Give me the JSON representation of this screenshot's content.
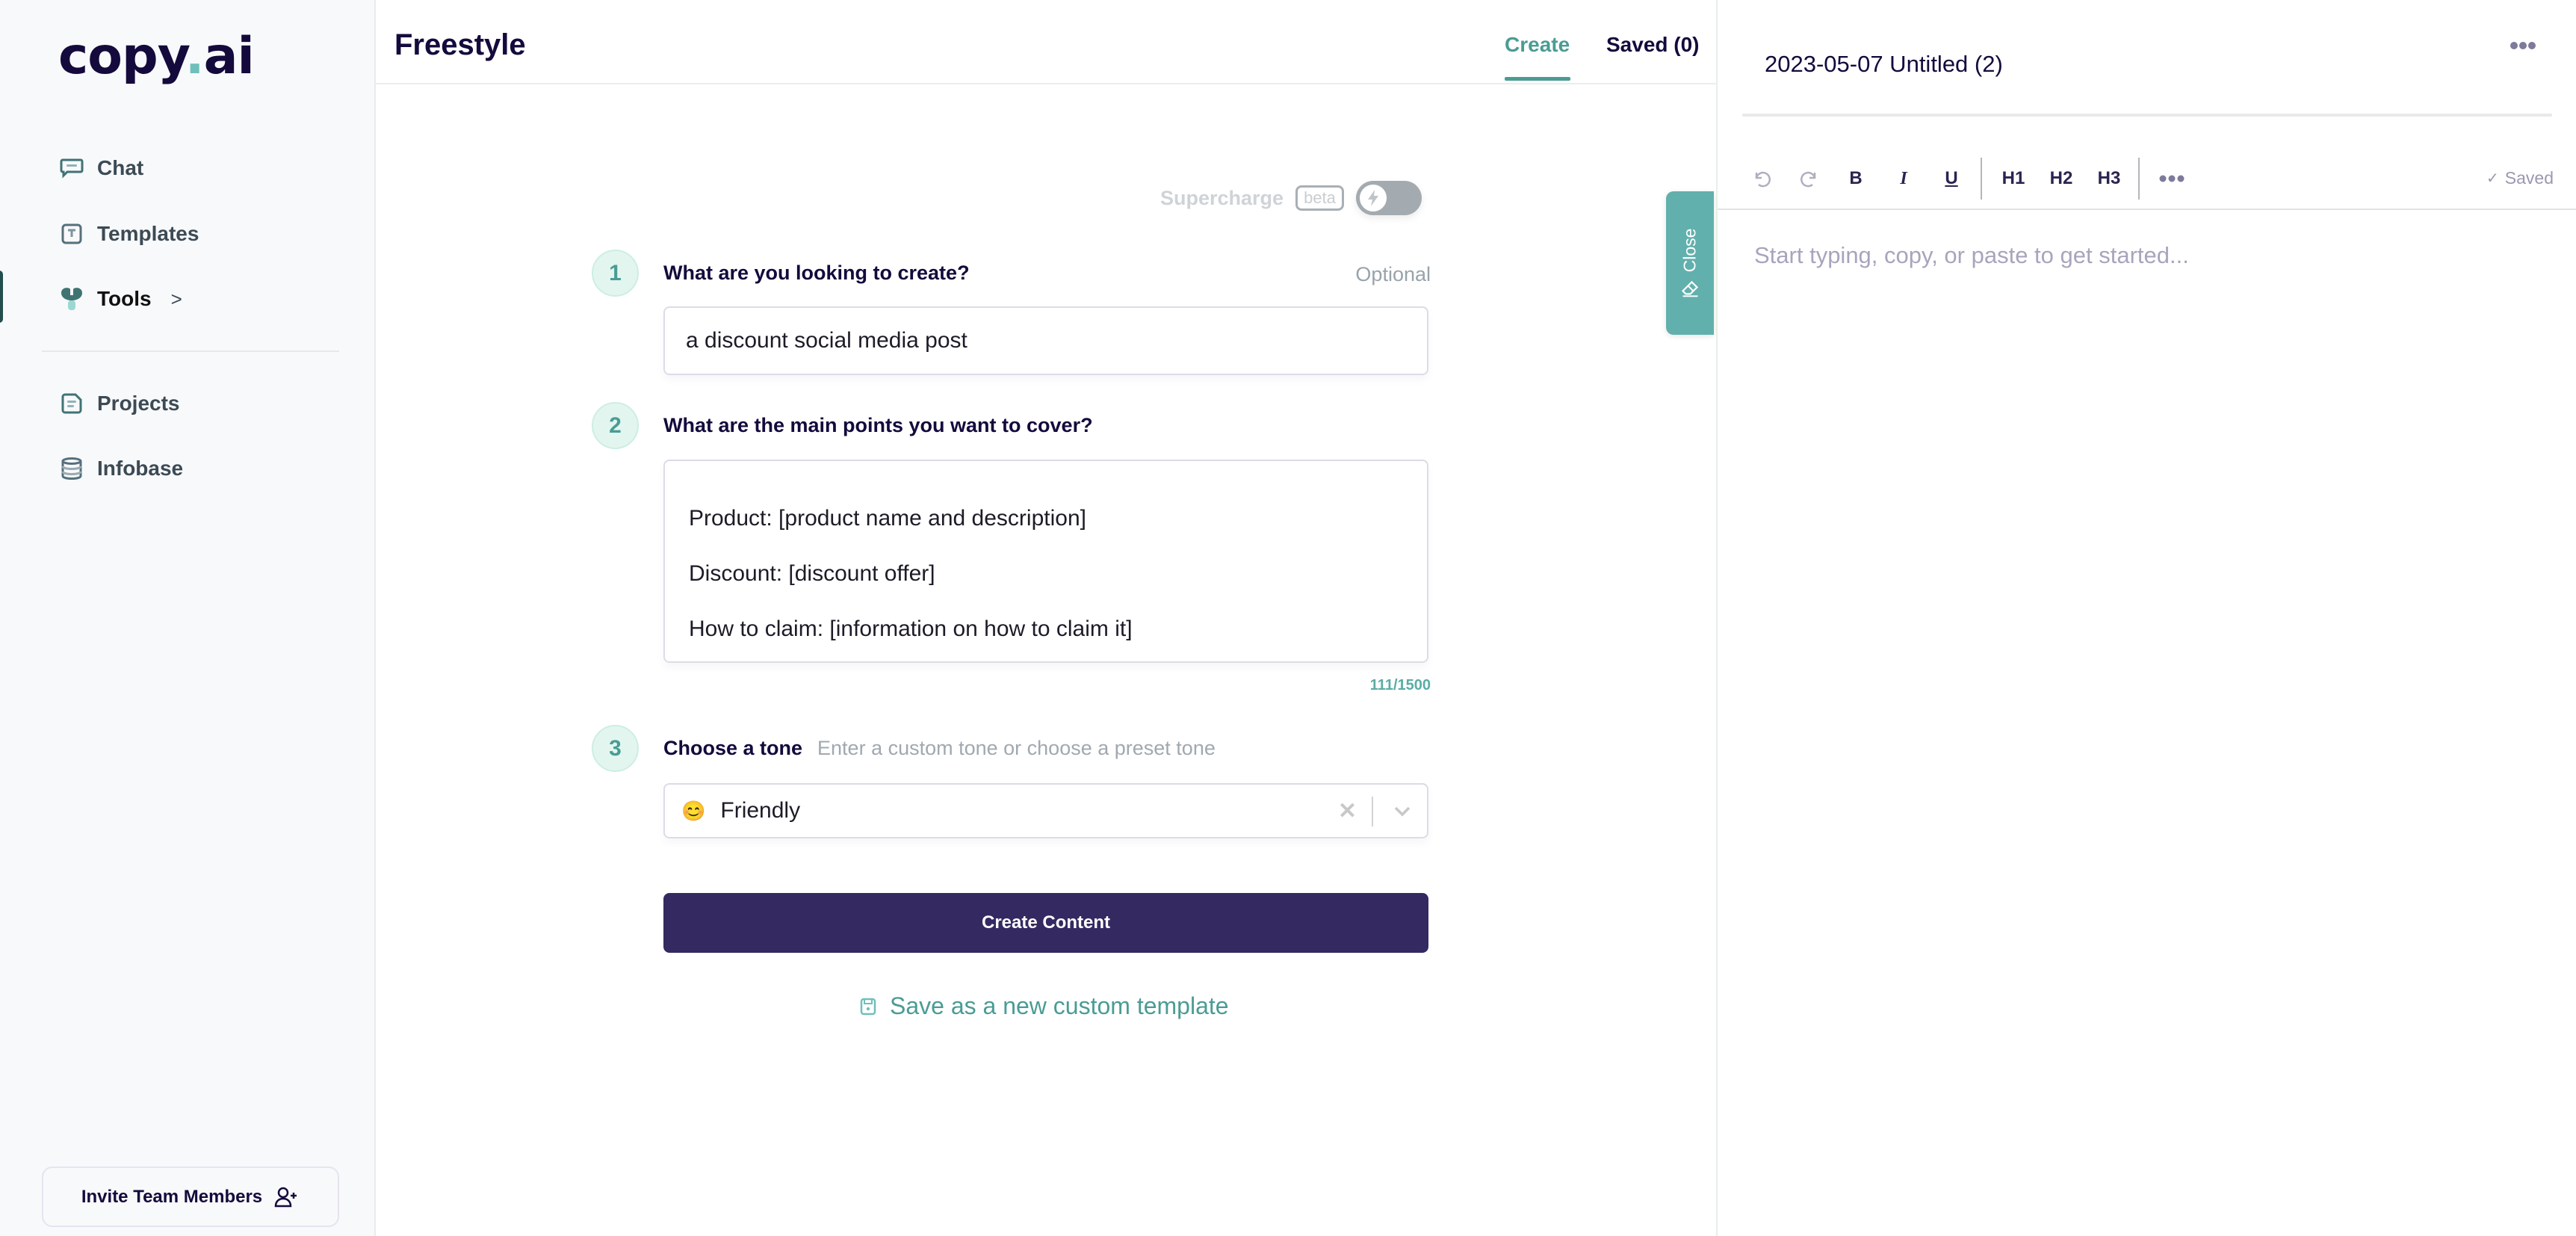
{
  "brand": {
    "logo_main": "copy",
    "logo_dot": ".",
    "logo_suffix": "ai",
    "accent": "#4a9c94",
    "primary": "#342961"
  },
  "sidebar": {
    "items": [
      {
        "label": "Chat",
        "icon": "chat-icon"
      },
      {
        "label": "Templates",
        "icon": "templates-icon"
      },
      {
        "label": "Tools",
        "icon": "tools-icon",
        "active": true,
        "chevron": ">"
      },
      {
        "label": "Projects",
        "icon": "projects-icon"
      },
      {
        "label": "Infobase",
        "icon": "infobase-icon"
      }
    ],
    "invite_label": "Invite Team Members"
  },
  "main": {
    "title": "Freestyle",
    "tabs": [
      {
        "label": "Create",
        "active": true
      },
      {
        "label": "Saved (0)"
      }
    ],
    "supercharge": {
      "label": "Supercharge",
      "badge": "beta",
      "enabled": false
    },
    "steps": [
      {
        "number": "1",
        "question": "What are you looking to create?",
        "optional_label": "Optional",
        "value": "a discount social media post"
      },
      {
        "number": "2",
        "question": "What are the main points you want to cover?",
        "lines": [
          "Product: [product name and description]",
          "Discount: [discount offer]",
          "How to claim: [information on how to claim it]"
        ],
        "counter": "111/1500"
      },
      {
        "number": "3",
        "question": "Choose a tone",
        "hint": "Enter a custom tone or choose a preset tone",
        "selected": {
          "emoji": "😊",
          "label": "Friendly"
        },
        "clear": "✕"
      }
    ],
    "create_button": "Create Content",
    "save_template": "Save as a new custom template",
    "close_tab": "Close"
  },
  "editor": {
    "doc_title": "2023-05-07 Untitled (2)",
    "toolbar": {
      "bold": "B",
      "italic": "I",
      "underline": "U",
      "h1": "H1",
      "h2": "H2",
      "h3": "H3"
    },
    "status": "Saved",
    "placeholder": "Start typing, copy, or paste to get started..."
  }
}
